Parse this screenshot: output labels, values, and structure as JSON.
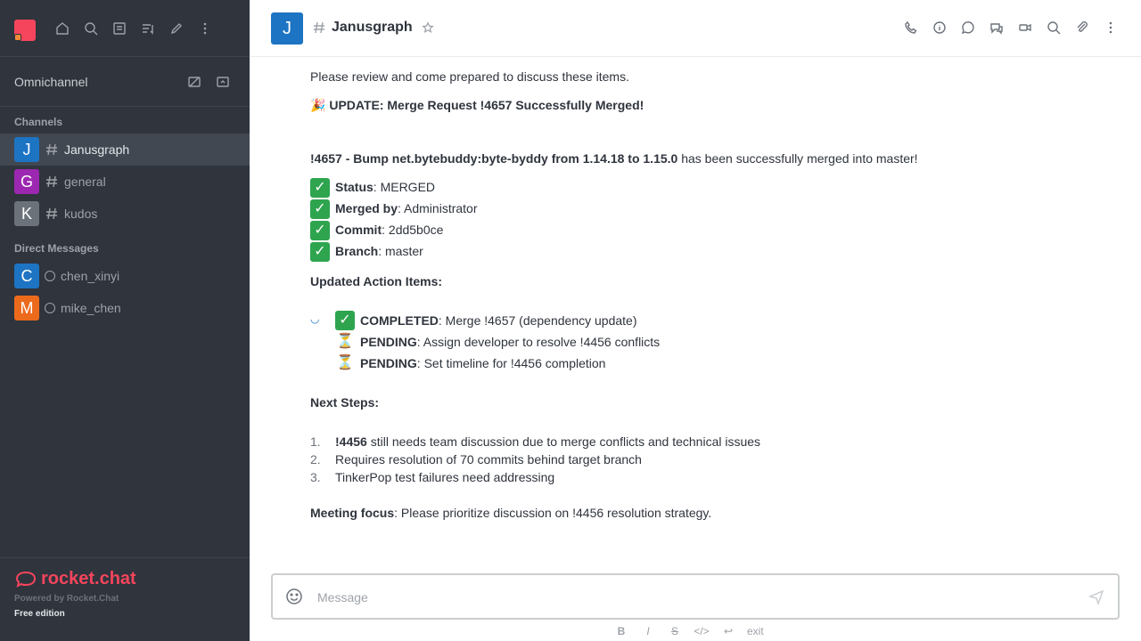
{
  "sidebar": {
    "omnichannel": "Omnichannel",
    "channels_title": "Channels",
    "channels": [
      {
        "initial": "J",
        "name": "Janusgraph",
        "color": "#1d74c3"
      },
      {
        "initial": "G",
        "name": "general",
        "color": "#9c27b0"
      },
      {
        "initial": "K",
        "name": "kudos",
        "color": "#6c727a"
      }
    ],
    "dm_title": "Direct Messages",
    "dms": [
      {
        "initial": "C",
        "name": "chen_xinyi",
        "color": "#1d74c3"
      },
      {
        "initial": "M",
        "name": "mike_chen",
        "color": "#ec6a1c"
      }
    ],
    "footer": {
      "logo": "rocket.chat",
      "powered": "Powered by Rocket.Chat",
      "edition": "Free edition"
    }
  },
  "header": {
    "initial": "J",
    "title": "Janusgraph"
  },
  "message": {
    "intro": "Please review and come prepared to discuss these items.",
    "update_emoji": "🎉",
    "update_title": "UPDATE: Merge Request !4657 Successfully Merged!",
    "mr_bold": "!4657 - Bump net.bytebuddy:byte-byddy from 1.14.18 to 1.15.0",
    "mr_rest": " has been successfully merged into master!",
    "status": [
      {
        "label": "Status",
        "value": ": MERGED"
      },
      {
        "label": "Merged by",
        "value": ": Administrator"
      },
      {
        "label": "Commit",
        "value": ": 2dd5b0ce"
      },
      {
        "label": "Branch",
        "value": ": master"
      }
    ],
    "action_title": "Updated Action Items:",
    "actions": [
      {
        "icon": "✅",
        "label": "COMPLETED",
        "value": ": Merge !4657 (dependency update)"
      },
      {
        "icon": "⏳",
        "label": "PENDING",
        "value": ": Assign developer to resolve !4456 conflicts"
      },
      {
        "icon": "⏳",
        "label": "PENDING",
        "value": ": Set timeline for !4456 completion"
      }
    ],
    "next_title": "Next Steps:",
    "next": [
      {
        "n": "1.",
        "bold": "!4456",
        "text": " still needs team discussion due to merge conflicts and technical issues"
      },
      {
        "n": "2.",
        "bold": "",
        "text": "Requires resolution of 70 commits behind target branch"
      },
      {
        "n": "3.",
        "bold": "",
        "text": "TinkerPop test failures need addressing"
      }
    ],
    "focus_label": "Meeting focus",
    "focus_text": ": Please prioritize discussion on !4456 resolution strategy."
  },
  "composer": {
    "placeholder": "Message"
  },
  "format": {
    "items": [
      "B",
      "I",
      "S",
      "</>",
      "↩"
    ],
    "extra": "exit"
  }
}
